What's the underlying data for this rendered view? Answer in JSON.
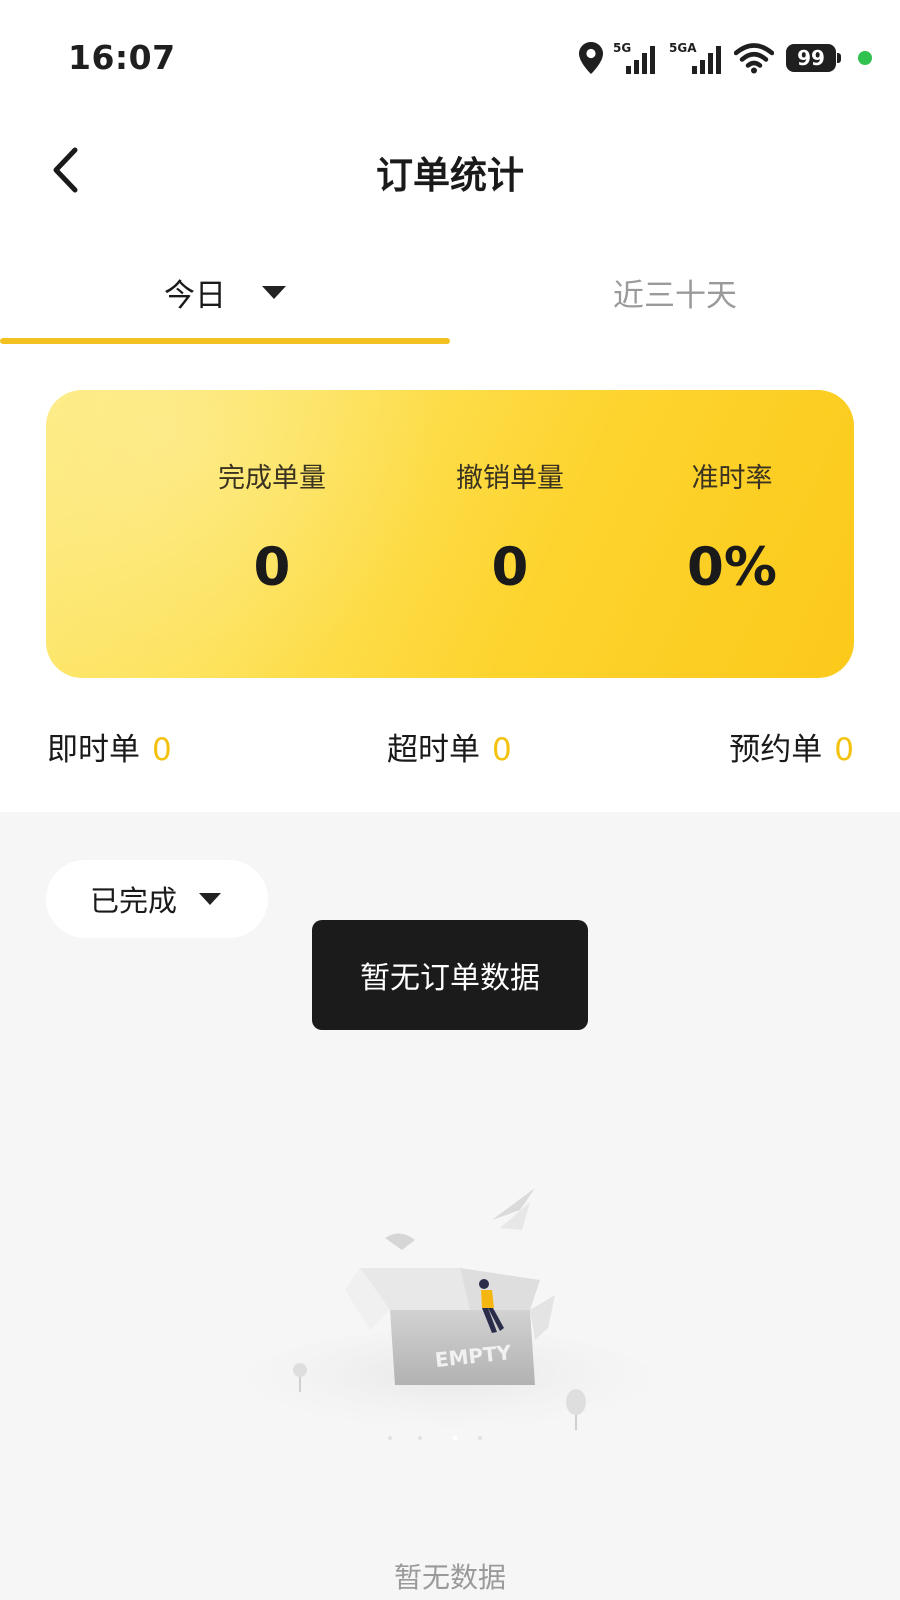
{
  "status_bar": {
    "time": "16:07",
    "network_1": "5G",
    "network_2": "5GA",
    "battery": "99",
    "icons": [
      "location-icon",
      "signal-icon",
      "signal-icon",
      "wifi-icon",
      "battery-icon"
    ],
    "indicator_color": "#2fc24f"
  },
  "header": {
    "title": "订单统计",
    "back_icon": "chevron-left-icon"
  },
  "tabs": [
    {
      "label": "今日",
      "active": true,
      "has_dropdown": true
    },
    {
      "label": "近三十天",
      "active": false
    }
  ],
  "summary": {
    "metrics": [
      {
        "label": "完成单量",
        "value": "0"
      },
      {
        "label": "撤销单量",
        "value": "0"
      },
      {
        "label": "准时率",
        "value": "0%"
      }
    ]
  },
  "counts": [
    {
      "label": "即时单",
      "value": "0"
    },
    {
      "label": "超时单",
      "value": "0"
    },
    {
      "label": "预约单",
      "value": "0"
    }
  ],
  "filter": {
    "selected": "已完成"
  },
  "toast": "暂无订单数据",
  "empty": {
    "text": "暂无数据",
    "illustration_label": "EMPTY"
  },
  "colors": {
    "accent": "#f2c120",
    "count_number": "#f4c20d",
    "card_start": "#fde977",
    "card_end": "#fcc91a"
  }
}
